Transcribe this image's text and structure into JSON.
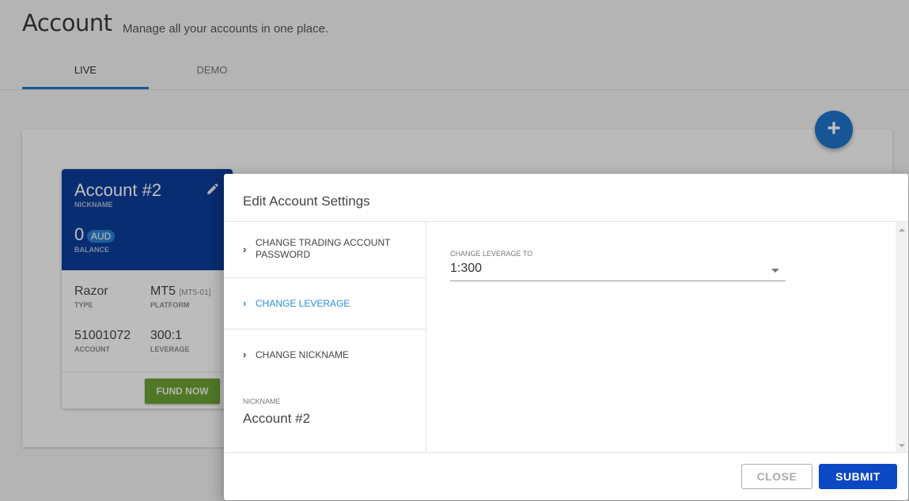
{
  "header": {
    "title": "Account",
    "subtitle": "Manage all your accounts in one place."
  },
  "tabs": [
    {
      "label": "LIVE",
      "active": true
    },
    {
      "label": "DEMO",
      "active": false
    }
  ],
  "fab": {
    "icon": "plus-icon",
    "symbol": "+"
  },
  "account_card": {
    "nickname": "Account #2",
    "nickname_label": "NICKNAME",
    "balance": "0",
    "currency": "AUD",
    "balance_label": "BALANCE",
    "edit_icon": "pencil-icon",
    "type_value": "Razor",
    "type_label": "TYPE",
    "platform_value": "MT5",
    "platform_tag": "[MT5-01]",
    "platform_label": "PLATFORM",
    "account_value": "51001072",
    "account_label": "ACCOUNT",
    "leverage_value": "300:1",
    "leverage_label": "LEVERAGE",
    "fund_button": "FUND NOW"
  },
  "dialog": {
    "title": "Edit Account Settings",
    "menu": [
      {
        "label": "CHANGE TRADING ACCOUNT PASSWORD",
        "active": false,
        "icon": "chevron-right-icon"
      },
      {
        "label": "CHANGE LEVERAGE",
        "active": true,
        "icon": "chevron-right-icon"
      },
      {
        "label": "CHANGE NICKNAME",
        "active": false,
        "icon": "chevron-right-icon"
      }
    ],
    "nickname_label": "NICKNAME",
    "nickname_value": "Account #2",
    "leverage_field": {
      "label": "CHANGE LEVERAGE TO",
      "value": "1:300"
    },
    "close_button": "CLOSE",
    "submit_button": "SUBMIT"
  },
  "colors": {
    "accent": "#1e73c8",
    "card_header": "#0d3c98",
    "fund_button": "#6b9f33",
    "submit_button": "#0d48c4",
    "active_menu": "#2a8de0"
  }
}
